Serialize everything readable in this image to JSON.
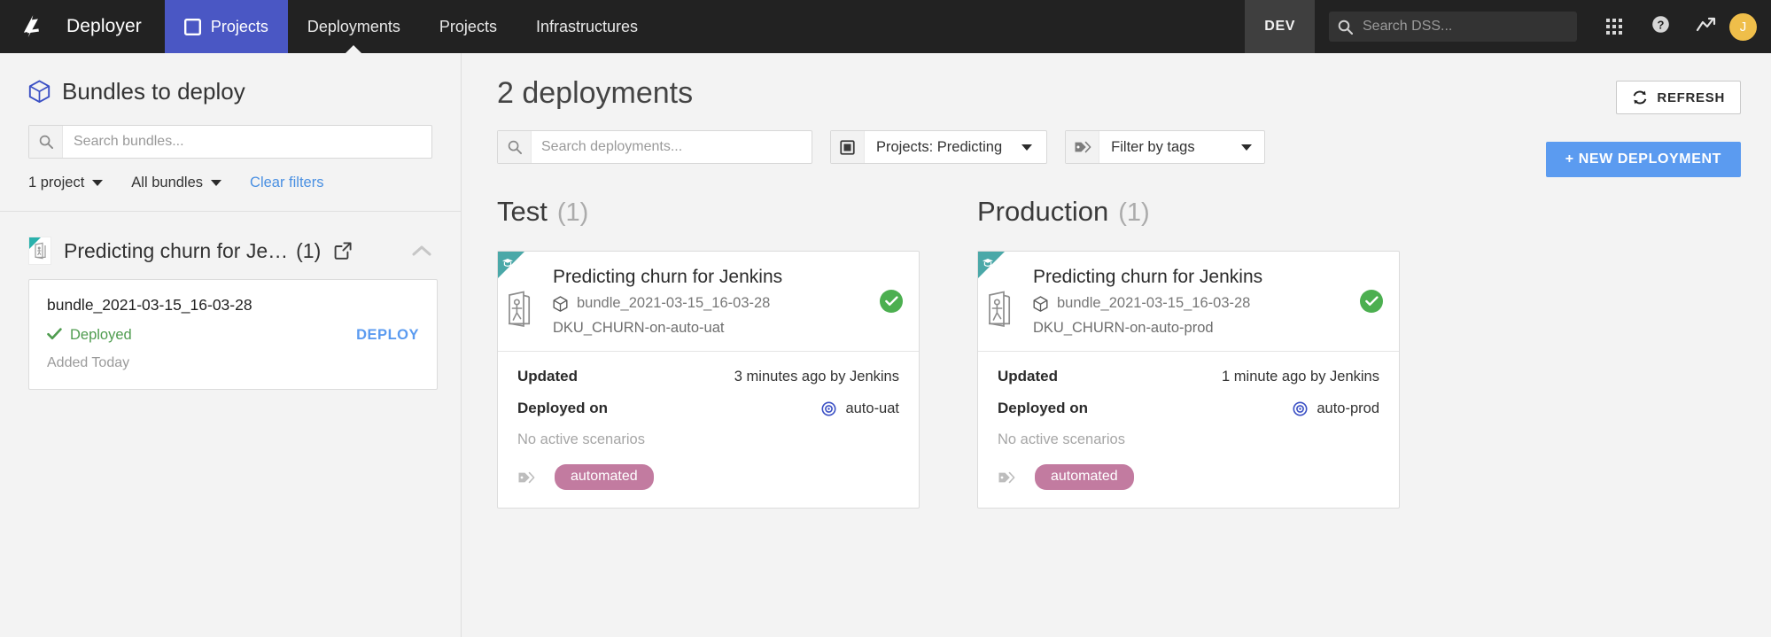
{
  "topnav": {
    "logo": "dataiku-bird-logo",
    "brand": "Deployer",
    "items": [
      {
        "label": "Projects",
        "icon": "window-icon",
        "active": true
      },
      {
        "label": "Deployments",
        "icon": "",
        "active": false
      },
      {
        "label": "Projects",
        "icon": "",
        "active": false
      },
      {
        "label": "Infrastructures",
        "icon": "",
        "active": false
      }
    ],
    "env_badge": "DEV",
    "search_placeholder": "Search DSS...",
    "search_value": "",
    "apps_icon": "grid-apps-icon",
    "help_icon": "question-circle-icon",
    "activity_icon": "trend-arrow-icon",
    "avatar_initial": "J",
    "avatar_color": "#efbe4a",
    "active_tab_color": "#4a57c4"
  },
  "sidebar": {
    "title": "Bundles to deploy",
    "title_icon": "cube-icon",
    "search_placeholder": "Search bundles...",
    "search_value": "",
    "filters": [
      {
        "label": "1 project",
        "name": "project-filter"
      },
      {
        "label": "All bundles",
        "name": "bundles-filter"
      }
    ],
    "clear_filters": "Clear filters",
    "project": {
      "name": "Predicting churn for Je…",
      "count": "(1)",
      "open_icon": "external-link-icon",
      "collapse_icon": "chevron-up-icon"
    },
    "bundle": {
      "name": "bundle_2021-03-15_16-03-28",
      "status": "Deployed",
      "status_icon": "check-icon",
      "status_color": "#4f9c4f",
      "deploy_label": "DEPLOY",
      "added": "Added Today"
    }
  },
  "main": {
    "title": "2 deployments",
    "search_placeholder": "Search deployments...",
    "search_value": "",
    "project_filter": {
      "label": "Projects: Predicting",
      "icon": "window-icon"
    },
    "tag_filter": {
      "label": "Filter by tags",
      "icon": "tag-icon"
    },
    "refresh_label": "REFRESH",
    "refresh_icon": "refresh-icon",
    "new_deployment_label": "+ NEW DEPLOYMENT",
    "new_deployment_color": "#5b9bf0",
    "columns": [
      {
        "heading": "Test",
        "count": "(1)",
        "card": {
          "title": "Predicting churn for Jenkins",
          "bundle": "bundle_2021-03-15_16-03-28",
          "bundle_icon": "cube-icon",
          "deployment_id": "DKU_CHURN-on-auto-uat",
          "status_icon": "check-circle-icon",
          "status_color": "#4caf50",
          "updated_label": "Updated",
          "updated_value": "3 minutes ago by Jenkins",
          "deployed_label": "Deployed on",
          "deployed_value": "auto-uat",
          "deployed_icon": "target-icon",
          "scenarios": "No active scenarios",
          "tag_icon": "tag-icon",
          "tag": "automated",
          "tag_color": "#c27ba0"
        }
      },
      {
        "heading": "Production",
        "count": "(1)",
        "card": {
          "title": "Predicting churn for Jenkins",
          "bundle": "bundle_2021-03-15_16-03-28",
          "bundle_icon": "cube-icon",
          "deployment_id": "DKU_CHURN-on-auto-prod",
          "status_icon": "check-circle-icon",
          "status_color": "#4caf50",
          "updated_label": "Updated",
          "updated_value": "1 minute ago by Jenkins",
          "deployed_label": "Deployed on",
          "deployed_value": "auto-prod",
          "deployed_icon": "target-icon",
          "scenarios": "No active scenarios",
          "tag_icon": "tag-icon",
          "tag": "automated",
          "tag_color": "#c27ba0"
        }
      }
    ]
  }
}
